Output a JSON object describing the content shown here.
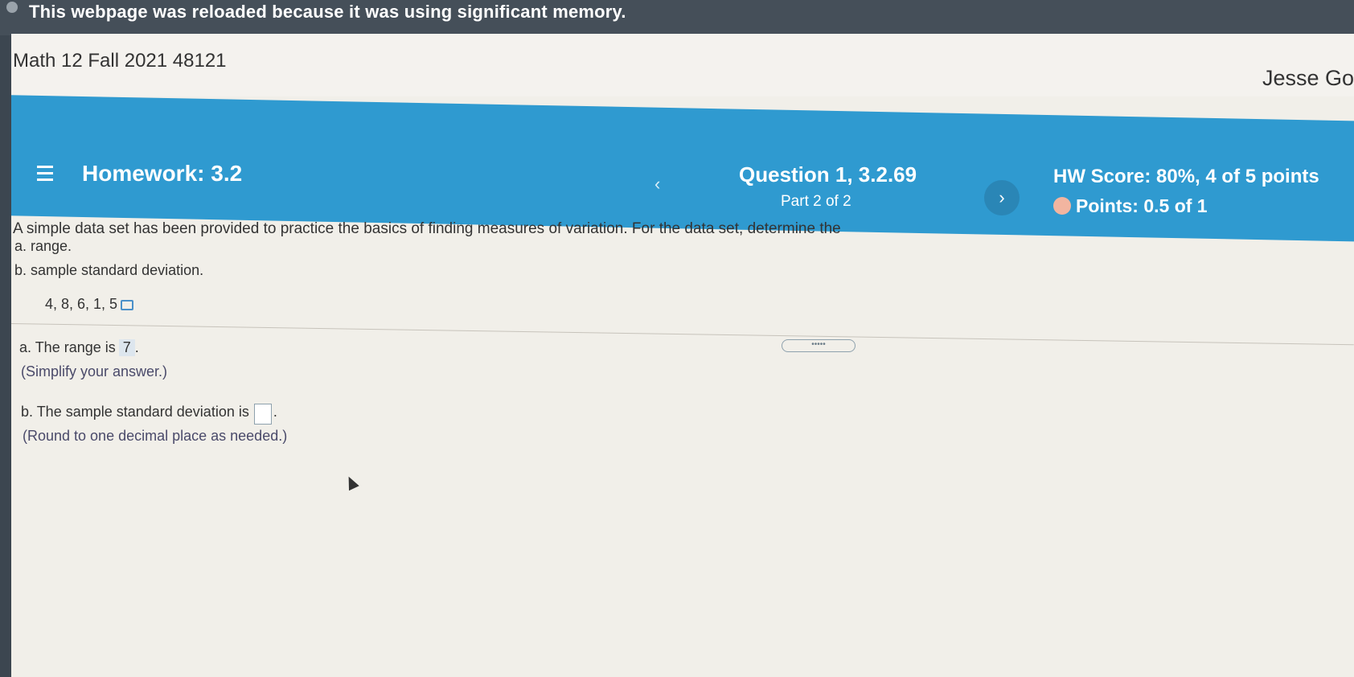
{
  "browser": {
    "warning": "This webpage was reloaded because it was using significant memory."
  },
  "course": {
    "title": "Math 12 Fall 2021 48121",
    "user": "Jesse Go"
  },
  "homework": {
    "label": "Homework: 3.2",
    "question": "Question 1, 3.2.69",
    "part": "Part 2 of 2",
    "prev_glyph": "‹",
    "next_glyph": "›",
    "hw_score": "HW Score: 80%, 4 of 5 points",
    "points": "Points: 0.5 of 1"
  },
  "question": {
    "prompt": "A simple data set has been provided to practice the basics of finding measures of variation. For the data set, determine the",
    "item_a": "a. range.",
    "item_b": "b. sample standard deviation.",
    "dataset": "4, 8, 6, 1, 5",
    "handle_glyph": "•••••"
  },
  "answers": {
    "a_prefix": "a. The range is",
    "a_value": "7",
    "a_suffix": ".",
    "a_hint": "(Simplify your answer.)",
    "b_prefix": "b. The sample standard deviation is",
    "b_value": "",
    "b_suffix": ".",
    "b_hint": "(Round to one decimal place as needed.)"
  }
}
